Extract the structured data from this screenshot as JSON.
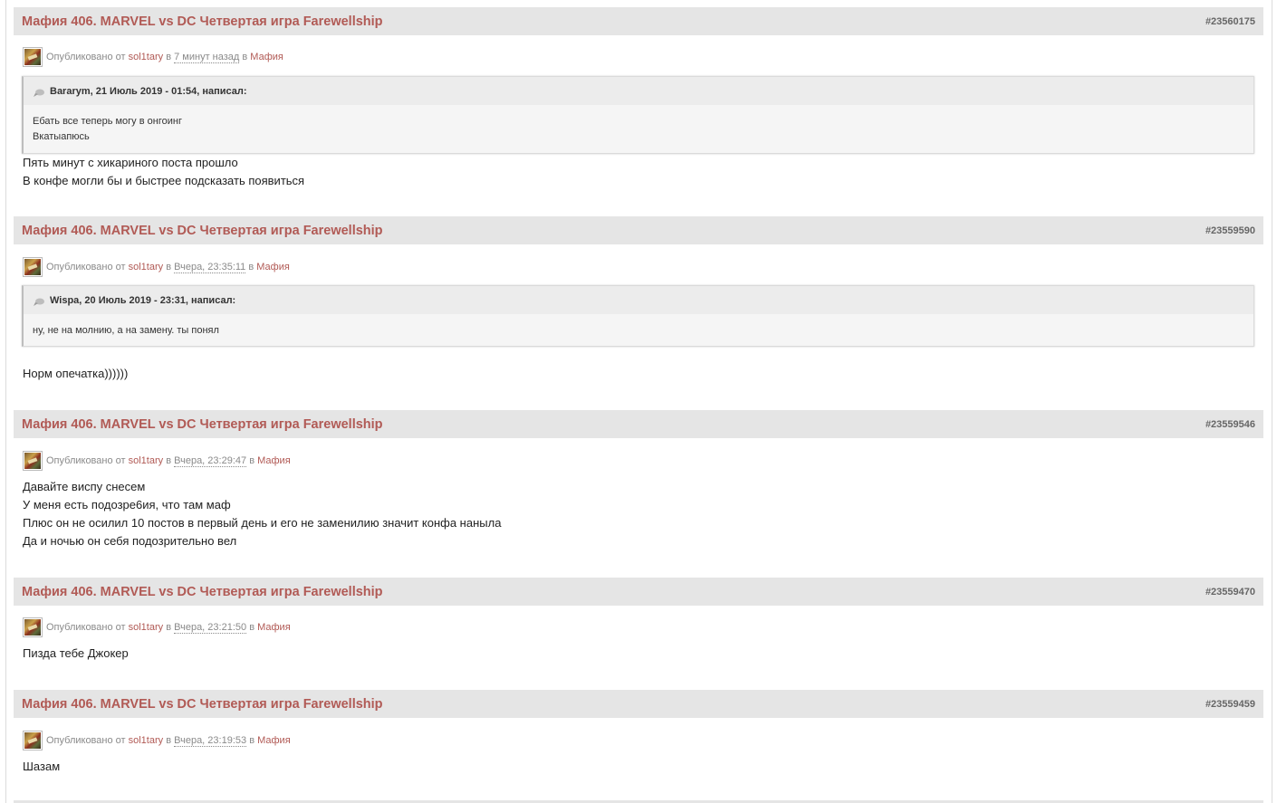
{
  "posts": [
    {
      "title": "Мафия 406. MARVEL vs DC Четвертая игра Farewellship",
      "id": "#23560175",
      "meta": {
        "published_by": "Опубликовано от",
        "user": "sol1tary",
        "in_word": "в",
        "time": "7 минут назад",
        "in_word2": "в",
        "forum": "Мафия"
      },
      "quote": {
        "header": "Bararym, 21 Июль 2019 - 01:54, написал:",
        "lines": [
          "Ебать все теперь могу в онгоинг",
          "Вкатыапюсь"
        ]
      },
      "lines": [
        "Пять минут с хикариного поста прошло",
        "В конфе могли бы и быстрее подсказать появиться"
      ]
    },
    {
      "title": "Мафия 406. MARVEL vs DC Четвертая игра Farewellship",
      "id": "#23559590",
      "meta": {
        "published_by": "Опубликовано от",
        "user": "sol1tary",
        "in_word": "в",
        "time": "Вчера, 23:35:11",
        "in_word2": "в",
        "forum": "Мафия"
      },
      "quote": {
        "header": "Wispa, 20 Июль 2019 - 23:31, написал:",
        "lines": [
          "ну, не на молнию, а на замену. ты понял"
        ]
      },
      "lines": [
        "Норм опечатка))))))"
      ]
    },
    {
      "title": "Мафия 406. MARVEL vs DC Четвертая игра Farewellship",
      "id": "#23559546",
      "meta": {
        "published_by": "Опубликовано от",
        "user": "sol1tary",
        "in_word": "в",
        "time": "Вчера, 23:29:47",
        "in_word2": "в",
        "forum": "Мафия"
      },
      "lines": [
        "Давайте виспу снесем",
        "У меня есть подозре6ия, что там маф",
        "Плюс он не осилил 10 постов в первый день и его не заменилию значит конфа нанылa",
        "Да и ночью он себя подозрительно вел"
      ]
    },
    {
      "title": "Мафия 406. MARVEL vs DC Четвертая игра Farewellship",
      "id": "#23559470",
      "meta": {
        "published_by": "Опубликовано от",
        "user": "sol1tary",
        "in_word": "в",
        "time": "Вчера, 23:21:50",
        "in_word2": "в",
        "forum": "Мафия"
      },
      "lines": [
        "Пизда тебе Джокер"
      ]
    },
    {
      "title": "Мафия 406. MARVEL vs DC Четвертая игра Farewellship",
      "id": "#23559459",
      "meta": {
        "published_by": "Опубликовано от",
        "user": "sol1tary",
        "in_word": "в",
        "time": "Вчера, 23:19:53",
        "in_word2": "в",
        "forum": "Мафия"
      },
      "lines": [
        "Шазам"
      ]
    }
  ],
  "colors": {
    "title": "#b15a55",
    "header_bg": "#e5e5e5",
    "meta_text": "#8a8a8a"
  },
  "icons": {
    "avatar": "user-avatar-image",
    "quote": "speech-bubble-icon"
  }
}
